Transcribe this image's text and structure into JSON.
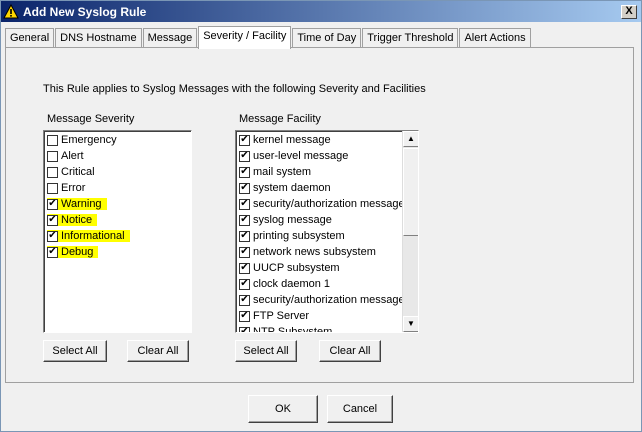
{
  "window": {
    "title": "Add New Syslog Rule",
    "close_label": "X"
  },
  "tabs": [
    {
      "label": "General",
      "active": false
    },
    {
      "label": "DNS Hostname",
      "active": false
    },
    {
      "label": "Message",
      "active": false
    },
    {
      "label": "Severity / Facility",
      "active": true
    },
    {
      "label": "Time of Day",
      "active": false
    },
    {
      "label": "Trigger Threshold",
      "active": false
    },
    {
      "label": "Alert Actions",
      "active": false
    }
  ],
  "panel": {
    "intro": "This Rule applies to Syslog Messages with the following Severity and Facilities",
    "severity": {
      "label": "Message Severity",
      "items": [
        {
          "label": "Emergency",
          "checked": false,
          "highlighted": false
        },
        {
          "label": "Alert",
          "checked": false,
          "highlighted": false
        },
        {
          "label": "Critical",
          "checked": false,
          "highlighted": false
        },
        {
          "label": "Error",
          "checked": false,
          "highlighted": false
        },
        {
          "label": "Warning",
          "checked": true,
          "highlighted": true
        },
        {
          "label": "Notice",
          "checked": true,
          "highlighted": true
        },
        {
          "label": "Informational",
          "checked": true,
          "highlighted": true
        },
        {
          "label": "Debug",
          "checked": true,
          "highlighted": true
        }
      ],
      "select_all": "Select All",
      "clear_all": "Clear All"
    },
    "facility": {
      "label": "Message Facility",
      "items": [
        {
          "label": "kernel message",
          "checked": true
        },
        {
          "label": "user-level message",
          "checked": true
        },
        {
          "label": "mail system",
          "checked": true
        },
        {
          "label": "system daemon",
          "checked": true
        },
        {
          "label": "security/authorization message",
          "checked": true
        },
        {
          "label": "syslog message",
          "checked": true
        },
        {
          "label": "printing subsystem",
          "checked": true
        },
        {
          "label": "network news subsystem",
          "checked": true
        },
        {
          "label": "UUCP subsystem",
          "checked": true
        },
        {
          "label": "clock daemon 1",
          "checked": true
        },
        {
          "label": "security/authorization message",
          "checked": true
        },
        {
          "label": "FTP Server",
          "checked": true
        },
        {
          "label": "NTP Subsystem",
          "checked": true
        }
      ],
      "select_all": "Select All",
      "clear_all": "Clear All"
    }
  },
  "footer": {
    "ok": "OK",
    "cancel": "Cancel"
  },
  "colors": {
    "highlight": "#ffff00",
    "titlebar": "#0a246a"
  }
}
